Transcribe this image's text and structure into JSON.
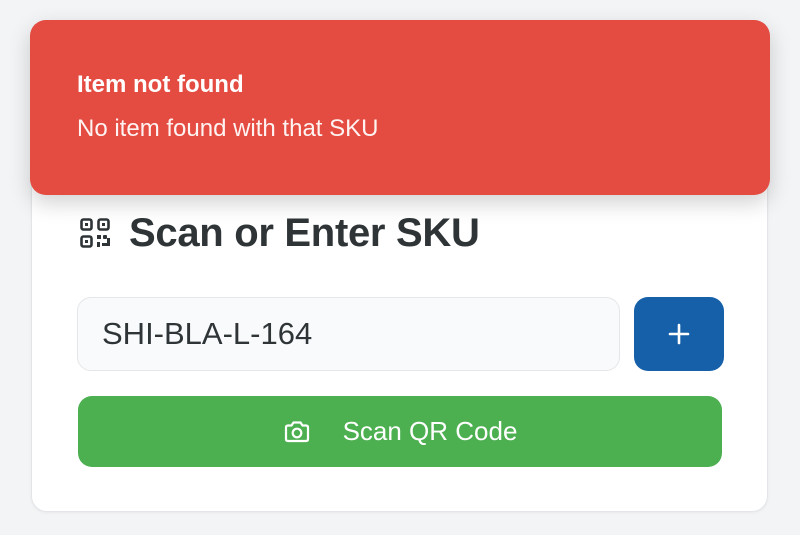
{
  "colors": {
    "toast_background": "#e44b41",
    "add_button_background": "#1560a8",
    "scan_button_background": "#4caf50",
    "text_dark": "#2f3437"
  },
  "toast": {
    "title": "Item not found",
    "message": "No item found with that SKU"
  },
  "scan_card": {
    "icon": "qr-code-icon",
    "title": "Scan or Enter SKU",
    "sku_input": {
      "value": "SHI-BLA-L-164",
      "placeholder": ""
    },
    "add_button": {
      "icon": "plus-icon"
    },
    "scan_button": {
      "icon": "camera-icon",
      "label": "Scan QR Code"
    }
  }
}
